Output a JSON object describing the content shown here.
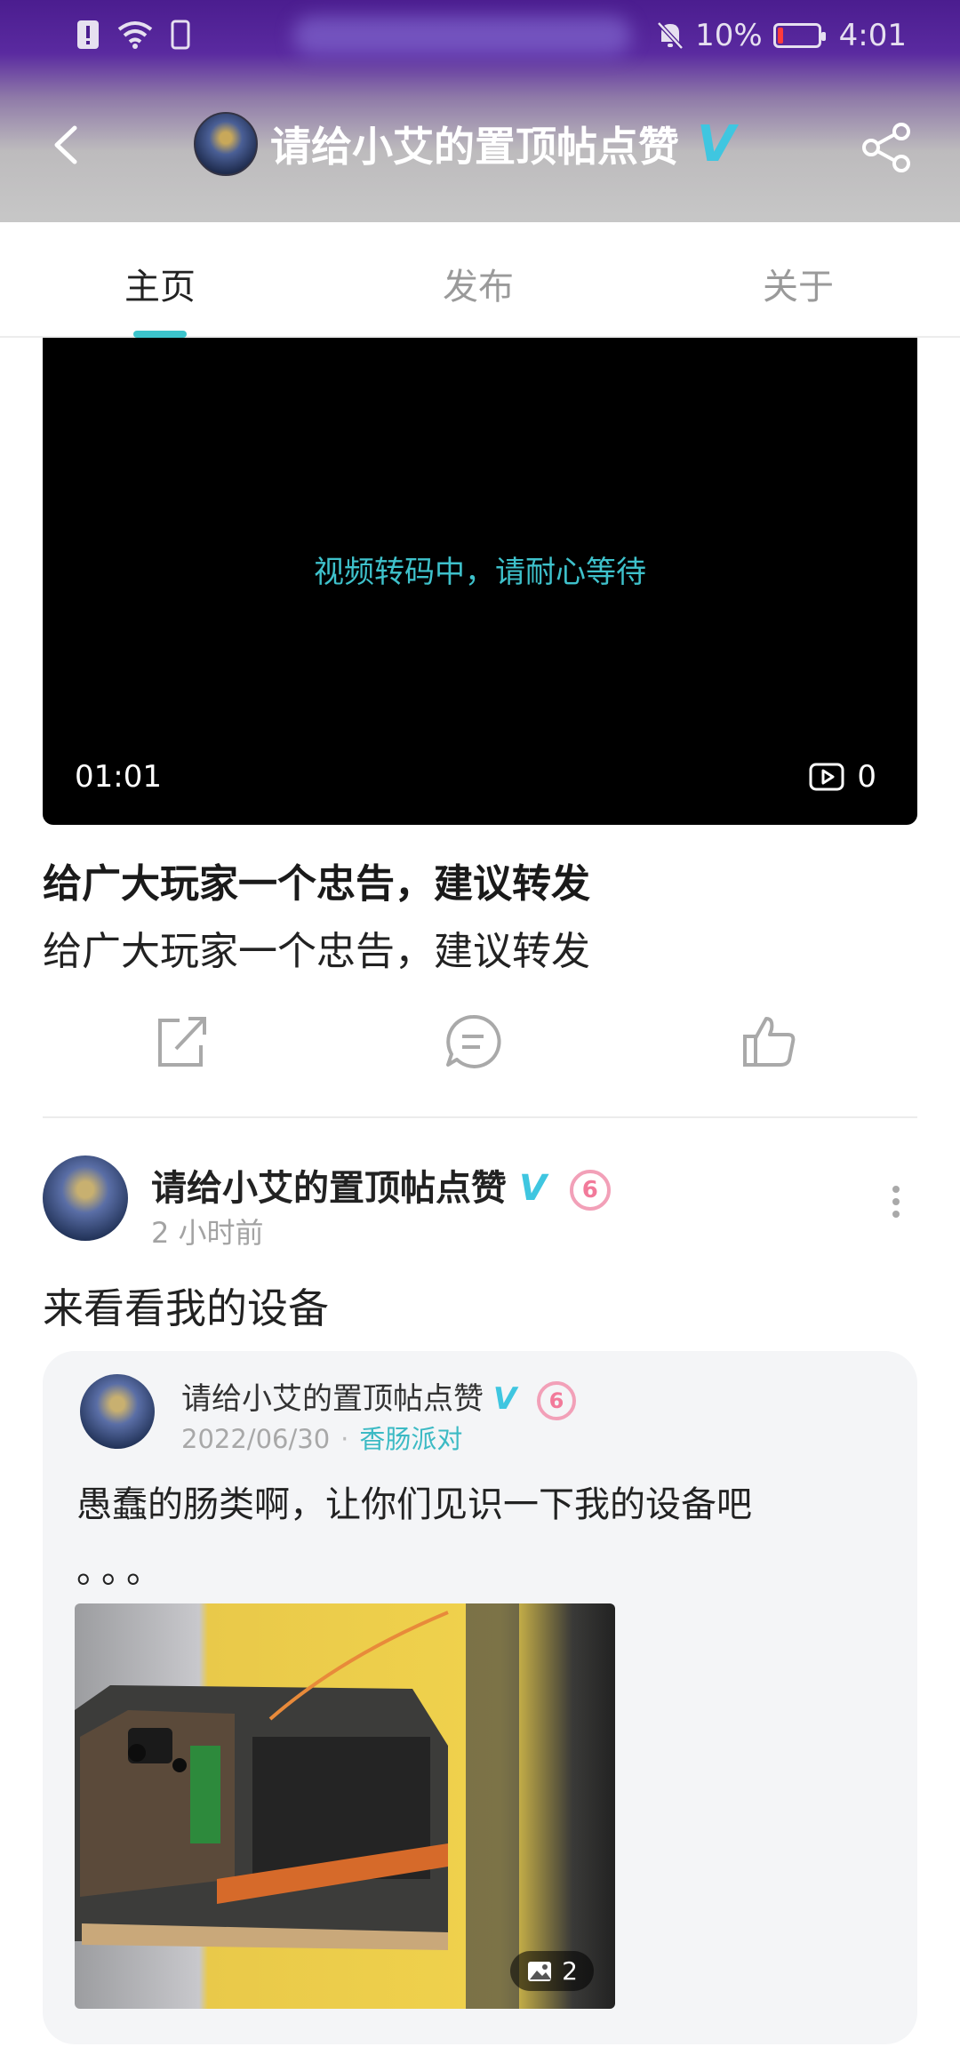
{
  "status_bar": {
    "battery": "10%",
    "time": "4:01"
  },
  "nav": {
    "title": "请给小艾的置顶帖点赞",
    "verified": "V"
  },
  "tabs": [
    "主页",
    "发布",
    "关于"
  ],
  "active_tab": "主页",
  "video": {
    "message": "视频转码中，请耐心等待",
    "duration": "01:01",
    "views": "0"
  },
  "post": {
    "title": "给广大玩家一个忠告，建议转发",
    "subtitle": "给广大玩家一个忠告，建议转发"
  },
  "feed_item": {
    "author": "请给小艾的置顶帖点赞",
    "verified": "V",
    "level_badge": "6",
    "time": "2 小时前",
    "text": "来看看我的设备",
    "quoted": {
      "author": "请给小艾的置顶帖点赞",
      "verified": "V",
      "level_badge": "6",
      "date": "2022/06/30",
      "separator": "·",
      "topic": "香肠派对",
      "text": "愚蠢的肠类啊，让你们见识一下我的设备吧",
      "dots": "。。。",
      "image_count": "2"
    }
  },
  "colors": {
    "accent": "#3cc4cc",
    "verified": "#3fc6e0",
    "level": "#f27a9a"
  }
}
